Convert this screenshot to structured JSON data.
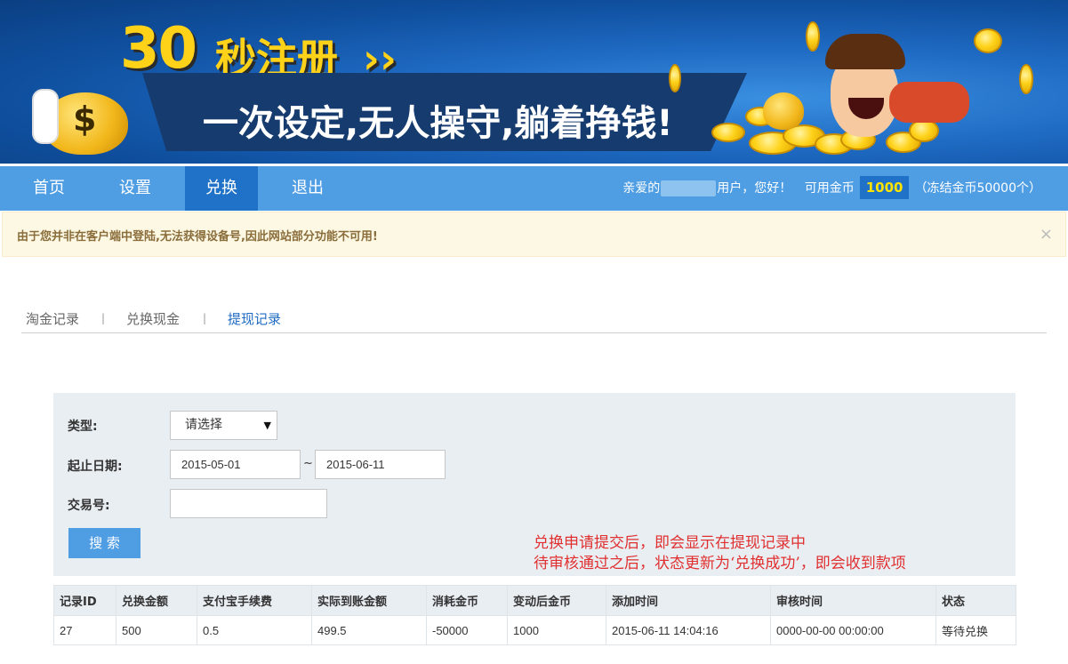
{
  "banner": {
    "headline_number": "30",
    "headline_text": "秒注册",
    "headline_arrow": "››",
    "slogan": "一次设定,无人操守,躺着挣钱!",
    "bag_symbol": "$"
  },
  "nav": {
    "items": [
      {
        "label": "首页"
      },
      {
        "label": "设置"
      },
      {
        "label": "兑换"
      },
      {
        "label": "退出"
      }
    ],
    "active_index": 2,
    "greeting_prefix": "亲爱的",
    "greeting_suffix": "用户，您好！",
    "available_label": "可用金币",
    "available_value": "1000",
    "frozen_text": "（冻结金币50000个）"
  },
  "alert": {
    "message": "由于您并非在客户端中登陆,无法获得设备号,因此网站部分功能不可用!",
    "close_symbol": "×"
  },
  "tabs": [
    {
      "label": "淘金记录"
    },
    {
      "label": "兑换现金"
    },
    {
      "label": "提现记录"
    }
  ],
  "tab_separator": "|",
  "filter": {
    "type_label": "类型:",
    "type_value": "请选择",
    "type_arrow": "▼",
    "date_label": "起止日期:",
    "date_start": "2015-05-01",
    "date_separator": "~",
    "date_end": "2015-06-11",
    "txn_label": "交易号:",
    "txn_value": "",
    "search_label": "搜 索"
  },
  "note": {
    "line1": "兑换申请提交后，即会显示在提现记录中",
    "line2": "待审核通过之后，状态更新为‘兑换成功’，即会收到款项"
  },
  "table": {
    "headers": [
      "记录ID",
      "兑换金额",
      "支付宝手续费",
      "实际到账金额",
      "消耗金币",
      "变动后金币",
      "添加时间",
      "审核时间",
      "状态"
    ],
    "rows": [
      [
        "27",
        "500",
        "0.5",
        "499.5",
        "-50000",
        "1000",
        "2015-06-11 14:04:16",
        "0000-00-00 00:00:00",
        "等待兑换"
      ]
    ]
  },
  "colors": {
    "nav_bg": "#4f9ee4",
    "nav_active": "#1f72c7",
    "gold_value": "#ffe400",
    "note_red": "#e03030",
    "tab_active": "#1f6bc4"
  }
}
